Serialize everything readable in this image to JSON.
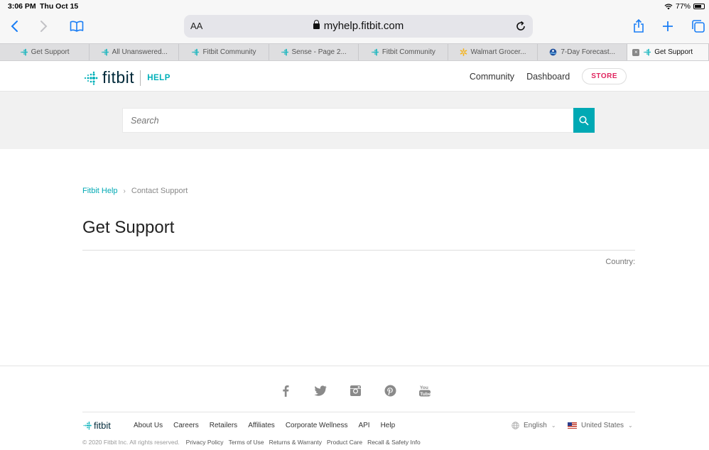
{
  "status_bar": {
    "time": "3:06 PM",
    "date": "Thu Oct 15",
    "battery": "77%",
    "battery_fraction": 0.77
  },
  "browser": {
    "text_size_label": "AA",
    "url": "myhelp.fitbit.com",
    "tabs": [
      {
        "label": "Get Support",
        "icon": "fitbit-favicon"
      },
      {
        "label": "All Unanswered...",
        "icon": "fitbit-favicon"
      },
      {
        "label": "Fitbit Community",
        "icon": "fitbit-favicon"
      },
      {
        "label": "Sense - Page 2...",
        "icon": "fitbit-favicon"
      },
      {
        "label": "Fitbit Community",
        "icon": "fitbit-favicon"
      },
      {
        "label": "Walmart Grocer...",
        "icon": "walmart-favicon"
      },
      {
        "label": "7-Day Forecast...",
        "icon": "noaa-favicon"
      },
      {
        "label": "Get Support",
        "icon": "fitbit-favicon",
        "active": true
      }
    ]
  },
  "header": {
    "brand": "fitbit",
    "section": "HELP",
    "nav": {
      "community": "Community",
      "dashboard": "Dashboard",
      "store": "STORE"
    }
  },
  "search": {
    "placeholder": "Search"
  },
  "breadcrumb": {
    "home": "Fitbit Help",
    "separator": "›",
    "current": "Contact Support"
  },
  "page": {
    "title": "Get Support",
    "country_label": "Country:"
  },
  "footer": {
    "brand": "fitbit",
    "social_icons": [
      "facebook-icon",
      "twitter-icon",
      "instagram-icon",
      "pinterest-icon",
      "youtube-icon"
    ],
    "links": [
      "About Us",
      "Careers",
      "Retailers",
      "Affiliates",
      "Corporate Wellness",
      "API",
      "Help"
    ],
    "language": "English",
    "region": "United States",
    "copyright": "© 2020 Fitbit Inc. All rights reserved.",
    "legal_links": [
      "Privacy Policy",
      "Terms of Use",
      "Returns & Warranty",
      "Product Care",
      "Recall & Safety Info"
    ]
  },
  "colors": {
    "accent": "#00a9b4",
    "store": "#e0245e",
    "ios_blue": "#1a7ef5"
  }
}
